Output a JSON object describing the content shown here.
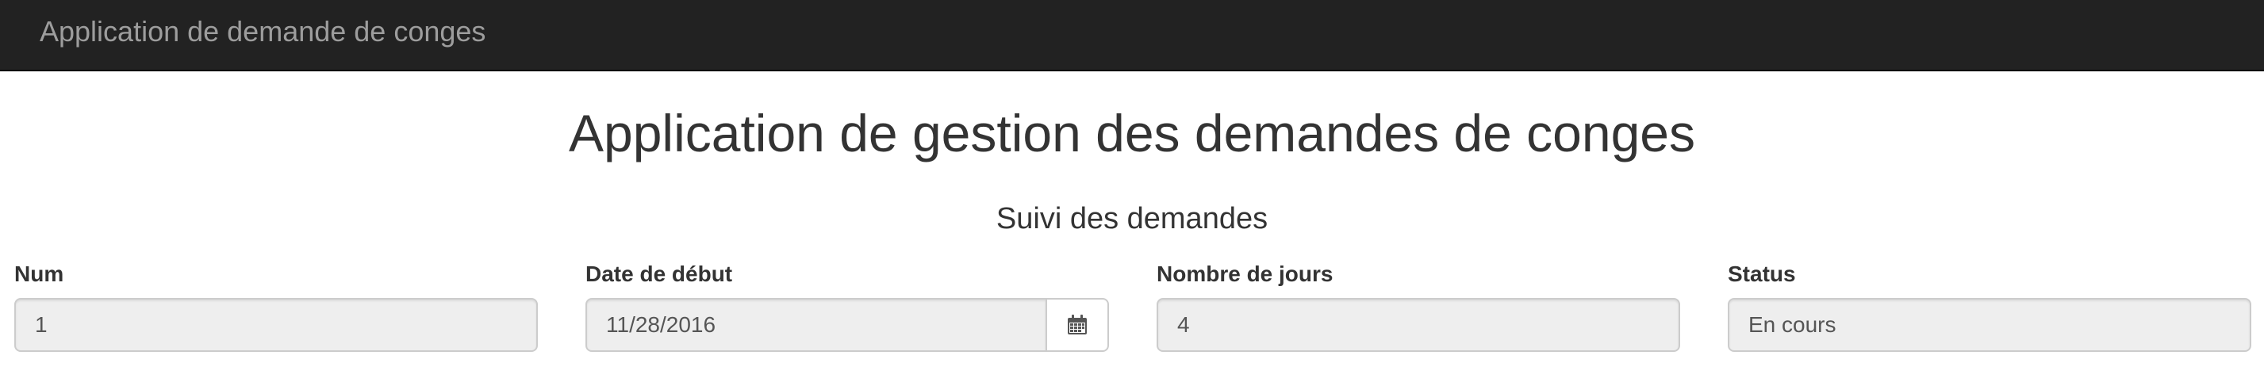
{
  "navbar": {
    "brand": "Application de demande de conges"
  },
  "page": {
    "title": "Application de gestion des demandes de conges",
    "subtitle": "Suivi des demandes"
  },
  "fields": {
    "num": {
      "label": "Num",
      "value": "1"
    },
    "date_debut": {
      "label": "Date de début",
      "value": "11/28/2016",
      "icon": "calendar-icon"
    },
    "nombre_jours": {
      "label": "Nombre de jours",
      "value": "4"
    },
    "status": {
      "label": "Status",
      "value": "En cours"
    }
  },
  "colors": {
    "navbar_bg": "#222222",
    "navbar_text": "#9d9d9d",
    "input_bg": "#eeeeee",
    "input_border": "#cccccc"
  }
}
